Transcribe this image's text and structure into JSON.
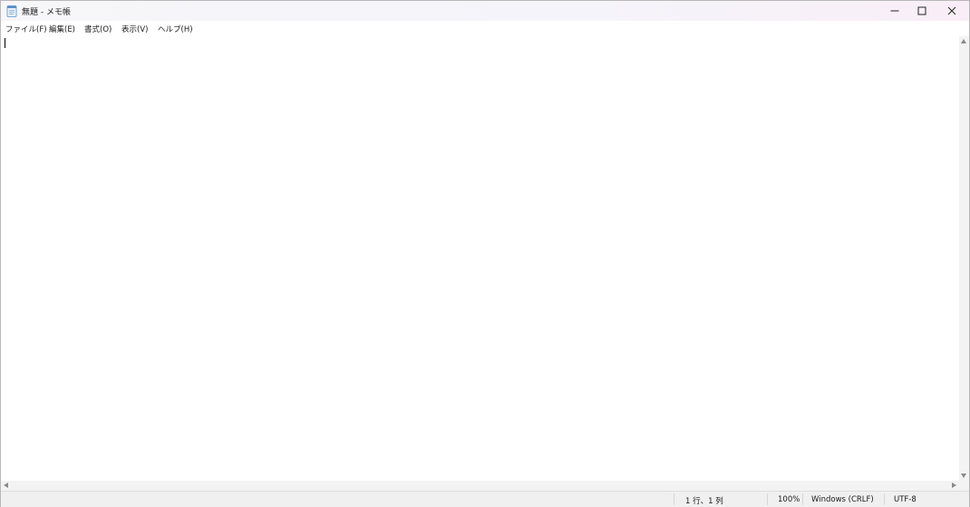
{
  "window": {
    "title": "無題 - メモ帳",
    "icon": "notepad-icon",
    "controls": {
      "minimize": "minimize-icon",
      "maximize": "maximize-icon",
      "close": "close-icon"
    }
  },
  "menu": {
    "items": [
      {
        "label": "ファイル(F)"
      },
      {
        "label": "編集(E)"
      },
      {
        "label": "書式(O)"
      },
      {
        "label": "表示(V)"
      },
      {
        "label": "ヘルプ(H)"
      }
    ]
  },
  "editor": {
    "content": ""
  },
  "status": {
    "position": "1 行、1 列",
    "zoom": "100%",
    "line_ending": "Windows (CRLF)",
    "encoding": "UTF-8"
  }
}
